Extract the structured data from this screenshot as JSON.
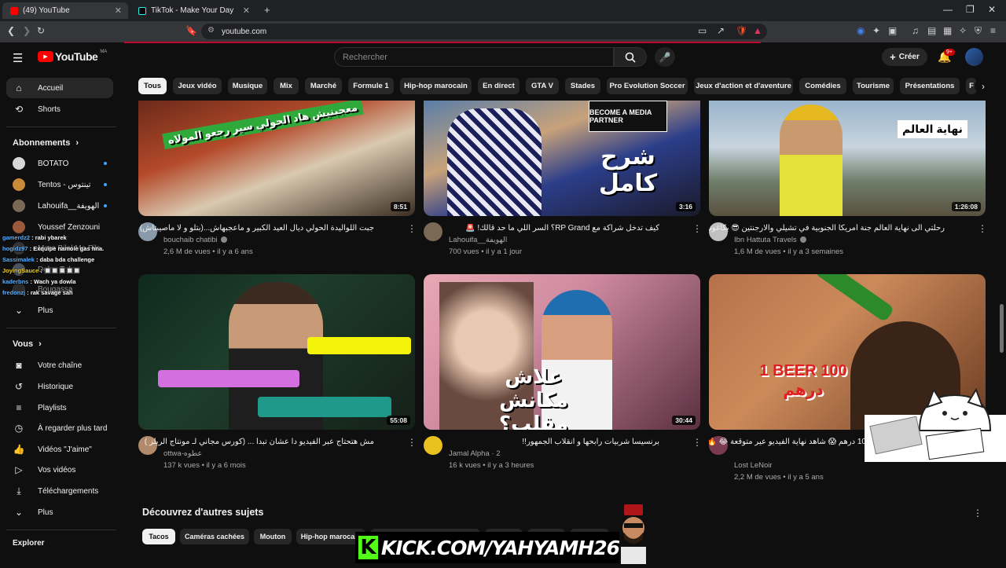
{
  "browser": {
    "tabs": [
      {
        "title": "(49) YouTube",
        "active": true
      },
      {
        "title": "TikTok - Make Your Day",
        "active": false
      }
    ],
    "new_tab": "+",
    "url": "youtube.com"
  },
  "header": {
    "logo": "YouTube",
    "logo_suffix": "MA",
    "search_placeholder": "Rechercher",
    "create_label": "Créer",
    "notifications": "9+"
  },
  "sidebar": {
    "main": [
      {
        "label": "Accueil",
        "icon": "home-icon",
        "active": true
      },
      {
        "label": "Shorts",
        "icon": "shorts-icon",
        "active": false
      }
    ],
    "subscriptions_heading": "Abonnements",
    "subscriptions": [
      {
        "label": "BOTATO",
        "color": "#d8d8d8"
      },
      {
        "label": "Tentos - تينتوس",
        "color": "#c98b3a"
      },
      {
        "label": "Lahouifa__الهويفة",
        "color": "#7a6a55"
      },
      {
        "label": "Youssef Zenzouni",
        "color": "#9b5a3c"
      },
      {
        "label": "Mora Bilal Mo Fils",
        "color": "#555"
      },
      {
        "label": "Dolce Tube",
        "color": "#7b8aa0"
      },
      {
        "label": "Bougassa",
        "color": "#444"
      }
    ],
    "more_label": "Plus",
    "you_heading": "Vous",
    "you_items": [
      {
        "label": "Votre chaîne",
        "icon": "channel-icon"
      },
      {
        "label": "Historique",
        "icon": "history-icon"
      },
      {
        "label": "Playlists",
        "icon": "playlists-icon"
      },
      {
        "label": "À regarder plus tard",
        "icon": "watch-later-icon"
      },
      {
        "label": "Vidéos \"J'aime\"",
        "icon": "like-icon"
      },
      {
        "label": "Vos vidéos",
        "icon": "your-videos-icon"
      },
      {
        "label": "Téléchargements",
        "icon": "download-icon"
      }
    ],
    "more_label_2": "Plus",
    "explore_heading": "Explorer"
  },
  "chips": [
    "Tous",
    "Jeux vidéo",
    "Musique",
    "Mix",
    "Marché",
    "Formule 1",
    "Hip-hop marocain",
    "En direct",
    "GTA V",
    "Stades",
    "Pro Evolution Soccer",
    "Jeux d'action et d'aventure",
    "Comédies",
    "Tourisme",
    "Présentations",
    "F"
  ],
  "videos": [
    {
      "title": "جبت اللواليدة الحولي ديال العيد الكبير و ماعجبهاش...(بتلو و لا ماصيبتاش)",
      "channel": "bouchaib chatibi",
      "verified": true,
      "views": "2,6 M de vues",
      "age": "il y a 6 ans",
      "duration": "8:51",
      "overlay": "معجبنيش هاد الحولي سير رجعو المولاه"
    },
    {
      "title": "كيف تدخل شراكة مع RP Grand؟ السر اللي ما حد قالك! 🚨",
      "channel": "Lahouifa__الهويفة",
      "verified": false,
      "views": "700 vues",
      "age": "il y a 1 jour",
      "duration": "3:16",
      "overlay": "شرح كامل"
    },
    {
      "title": "رحلتي الى نهاية العالم جنة أمريكا الجنوبية في تشيلي والارجنتين 😎 بكاغونيا",
      "channel": "Ibn Hattuta Travels",
      "verified": true,
      "views": "1,6 M de vues",
      "age": "il y a 3 semaines",
      "duration": "1:26:08",
      "overlay": "نهاية العالم"
    },
    {
      "title": "مش هتحتاج عبر الفيديو دا عشان تبدأ ... (كورس مجاني لـ مونتاج الريلز )",
      "channel": "ottwa-عطوه",
      "verified": false,
      "views": "137 k vues",
      "age": "il y a 6 mois",
      "duration": "55:08",
      "overlay": ""
    },
    {
      "title": "برنسيسا شربيات رابحها و انقلاب الجمهور!!",
      "channel": "Jamal Alpha · 2",
      "verified": false,
      "views": "16 k vues",
      "age": "il y a 3 heures",
      "duration": "30:44",
      "overlay": "علاش مكانش مقلب؟"
    },
    {
      "title": "10 درهم 😱 شاهد نهاية الفيديو عير متوقعة 😂 🔥",
      "channel": "Lost LeNoir",
      "verified": false,
      "views": "2,2 M de vues",
      "age": "il y a 5 ans",
      "duration": "",
      "overlay": "1 BEER 100 درهم"
    }
  ],
  "topics_heading": "Découvrez d'autres sujets",
  "topic_chips": [
    "Tacos",
    "Caméras cachées",
    "Mouton",
    "Hip-hop marocain",
    "RP Grand - Open World Game",
    "Burritos",
    "Déserts",
    "Bureaux"
  ],
  "chat": [
    {
      "user": "gamerdz2",
      "msg": ": rabi ybarek"
    },
    {
      "user": "hogidz97",
      "msg": ": Exquipe namole gas hna."
    },
    {
      "user": "Sassimalek",
      "msg": ": daba bda challenge"
    },
    {
      "user": "JoyingSauce",
      "msg": ": 🔲🔲🔲🔲🔲"
    },
    {
      "user": "kaderbns",
      "msg": ": Wach ya dowla"
    },
    {
      "user": "fredonzj",
      "msg": ": rak savage sah"
    }
  ],
  "kick_banner": "KICK.COM/YAHYAMH26",
  "kick_logo": "K",
  "colors": {
    "accent": "#ff0000",
    "kick": "#53fc18",
    "link": "#3ea6ff"
  }
}
